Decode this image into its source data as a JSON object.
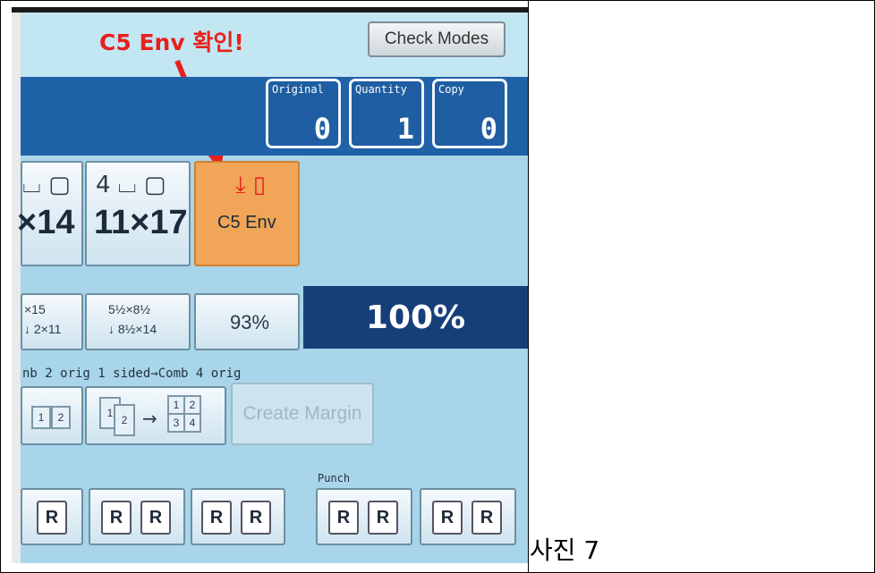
{
  "annotation": {
    "text": "C5 Env 확인!",
    "color": "#e8201d"
  },
  "top_bar": {
    "check_modes_label": "Check Modes"
  },
  "counters": [
    {
      "label": "Original",
      "value": "0"
    },
    {
      "label": "Quantity",
      "value": "1"
    },
    {
      "label": "Copy",
      "value": "0"
    }
  ],
  "paper_trays": [
    {
      "icons": "⌴ ▢",
      "size": "×14"
    },
    {
      "icons": "4 ⌴ ▢",
      "size": "11×17"
    },
    {
      "icons": "⤓ ▯",
      "size": "C5 Env",
      "selected": true
    }
  ],
  "ratio_buttons": [
    {
      "line1": "×15",
      "line2": "↓ 2×11"
    },
    {
      "line1": "5½×8½",
      "line2": "↓ 8½×14"
    },
    {
      "line1": "93%"
    }
  ],
  "zoom_display": "100%",
  "combine_line": "nb 2 orig 1 sided→Comb 4 orig",
  "combine_buttons": {
    "pages_a": [
      "1",
      "2"
    ],
    "pages_b": [
      "1",
      "2"
    ],
    "arrow": "→",
    "grid": [
      "1",
      "2",
      "3",
      "4"
    ],
    "create_margin_label": "Create Margin"
  },
  "punch_label": "Punch",
  "staple_letter": "R",
  "caption": "사진 7",
  "colors": {
    "screen_bg": "#a9d5ea",
    "blue_bar": "#1f62a8",
    "selected_tray": "#f0a558",
    "zoom_bg": "#163f7a"
  }
}
